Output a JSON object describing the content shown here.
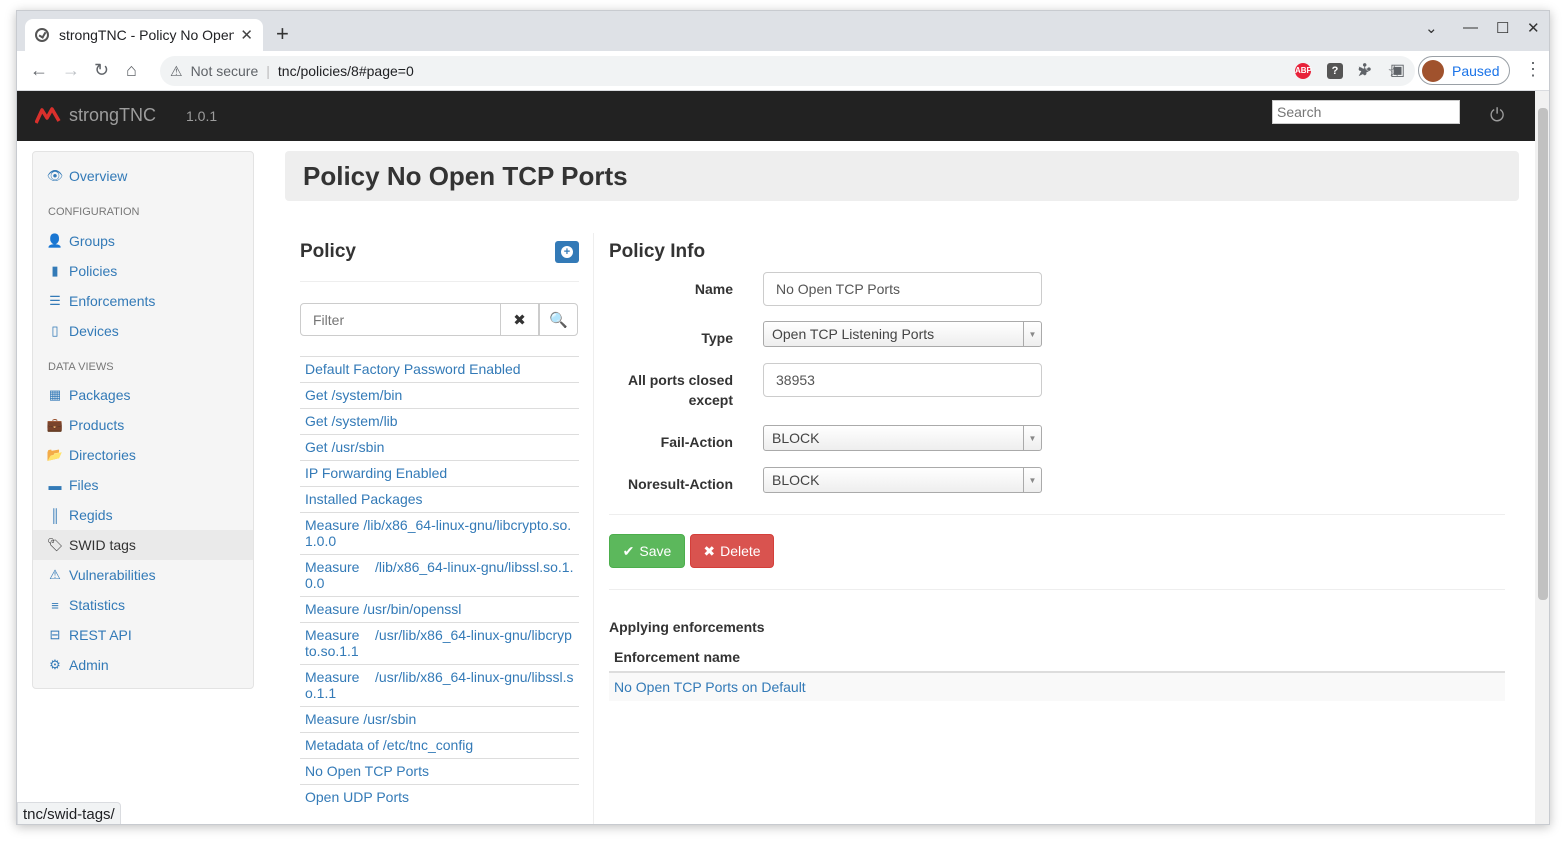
{
  "browser": {
    "tab_title": "strongTNC - Policy No Open TCP Ports",
    "tab_close": "✕",
    "new_tab": "+",
    "not_secure": "Not secure",
    "url": "tnc/policies/8#page=0",
    "profile_label": "Paused",
    "status_url": "tnc/swid-tags/"
  },
  "app": {
    "brand": "strongTNC",
    "version": "1.0.1",
    "search_placeholder": "Search"
  },
  "sidebar": {
    "overview": "Overview",
    "config_header": "CONFIGURATION",
    "groups": "Groups",
    "policies": "Policies",
    "enforcements": "Enforcements",
    "devices": "Devices",
    "dataviews_header": "DATA VIEWS",
    "packages": "Packages",
    "products": "Products",
    "directories": "Directories",
    "files": "Files",
    "regids": "Regids",
    "swid_tags": "SWID tags",
    "vulnerabilities": "Vulnerabilities",
    "statistics": "Statistics",
    "rest_api": "REST API",
    "admin": "Admin"
  },
  "page": {
    "title": "Policy No Open TCP Ports"
  },
  "policy_list": {
    "heading": "Policy",
    "filter_placeholder": "Filter",
    "items": [
      "Default Factory Password Enabled",
      "Get /system/bin",
      "Get /system/lib",
      "Get /usr/sbin",
      "IP Forwarding Enabled",
      "Installed Packages",
      "Measure  /lib/x86_64-linux-gnu/libcrypto.so.1.0.0",
      "Measure    /lib/x86_64-linux-gnu/libssl.so.1.0.0",
      "Measure /usr/bin/openssl",
      "Measure    /usr/lib/x86_64-linux-gnu/libcrypto.so.1.1",
      "Measure    /usr/lib/x86_64-linux-gnu/libssl.so.1.1",
      "Measure /usr/sbin",
      "Metadata of /etc/tnc_config",
      "No Open TCP Ports",
      "Open UDP Ports"
    ]
  },
  "policy_info": {
    "heading": "Policy Info",
    "name_label": "Name",
    "name_value": "No Open TCP Ports",
    "type_label": "Type",
    "type_value": "Open TCP Listening Ports",
    "ports_label": "All ports closed except",
    "ports_value": "38953",
    "fail_label": "Fail-Action",
    "fail_value": "BLOCK",
    "noresult_label": "Noresult-Action",
    "noresult_value": "BLOCK",
    "save": "Save",
    "delete": "Delete"
  },
  "enforcements": {
    "title": "Applying enforcements",
    "column": "Enforcement name",
    "rows": [
      "No Open TCP Ports on Default"
    ]
  }
}
